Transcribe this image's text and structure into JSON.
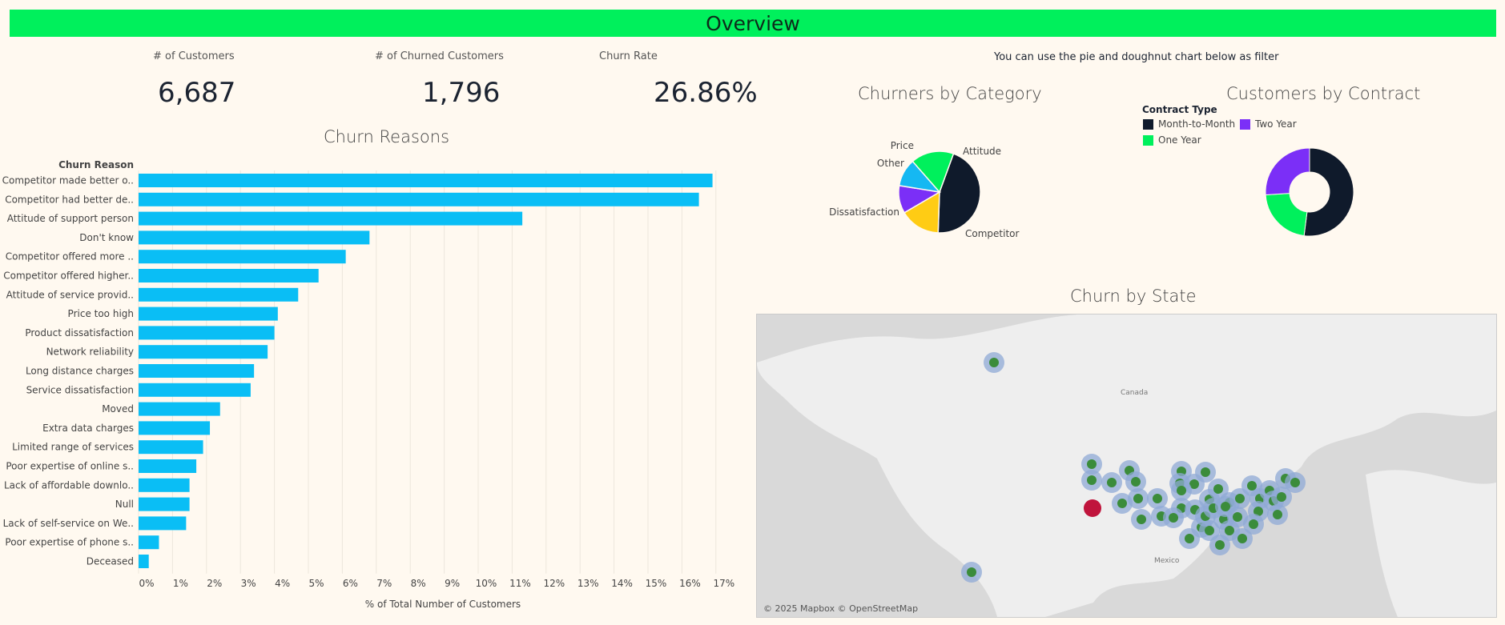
{
  "header": {
    "title": "Overview"
  },
  "kpis": [
    {
      "label": "# of Customers",
      "value": "6,687"
    },
    {
      "label": "# of Churned Customers",
      "value": "1,796"
    },
    {
      "label": "Churn Rate",
      "value": "26.86%"
    }
  ],
  "filter_note": "You can use the pie and doughnut chart below as filter",
  "colors": {
    "bar": "#0abef5",
    "accent": "#00f05c",
    "dark": "#0f1a2b",
    "purple": "#7b2ff7",
    "yellow": "#ffcc14",
    "sky": "#15b8f2",
    "highlight": "#c0143c"
  },
  "map": {
    "title": "Churn by State",
    "labels": {
      "canada": "Canada",
      "mexico": "Mexico"
    },
    "credit": "© 2025 Mapbox © OpenStreetMap"
  },
  "chart_data": [
    {
      "type": "bar",
      "title": "Churn Reasons",
      "ylabel": "Churn Reason",
      "xlabel": "% of Total Number of Customers",
      "xlim": [
        0,
        17.5
      ],
      "xticks": [
        "0%",
        "1%",
        "2%",
        "3%",
        "4%",
        "5%",
        "6%",
        "7%",
        "8%",
        "9%",
        "10%",
        "11%",
        "12%",
        "13%",
        "14%",
        "15%",
        "16%",
        "17%"
      ],
      "categories": [
        "Competitor made better o..",
        "Competitor had better de..",
        "Attitude of support person",
        "Don't know",
        "Competitor offered more ..",
        "Competitor offered higher..",
        "Attitude of service provid..",
        "Price too high",
        "Product dissatisfaction",
        "Network reliability",
        "Long distance charges",
        "Service dissatisfaction",
        "Moved",
        "Extra data charges",
        "Limited range of services",
        "Poor expertise of online s..",
        "Lack of affordable downlo..",
        "Null",
        "Lack of self-service on We..",
        "Poor expertise of phone s..",
        "Deceased"
      ],
      "values": [
        16.9,
        16.5,
        11.3,
        6.8,
        6.1,
        5.3,
        4.7,
        4.1,
        4.0,
        3.8,
        3.4,
        3.3,
        2.4,
        2.1,
        1.9,
        1.7,
        1.5,
        1.5,
        1.4,
        0.6,
        0.3
      ]
    },
    {
      "type": "pie",
      "title": "Churners by Category",
      "categories": [
        "Competitor",
        "Dissatisfaction",
        "Other",
        "Price",
        "Attitude"
      ],
      "values": [
        45.0,
        16.0,
        11.0,
        11.0,
        17.0
      ]
    },
    {
      "type": "pie",
      "title": "Customers by Contract",
      "legend_title": "Contract Type",
      "categories": [
        "Month-to-Month",
        "Two Year",
        "One Year"
      ],
      "values": [
        52.0,
        26.0,
        22.0
      ]
    }
  ]
}
